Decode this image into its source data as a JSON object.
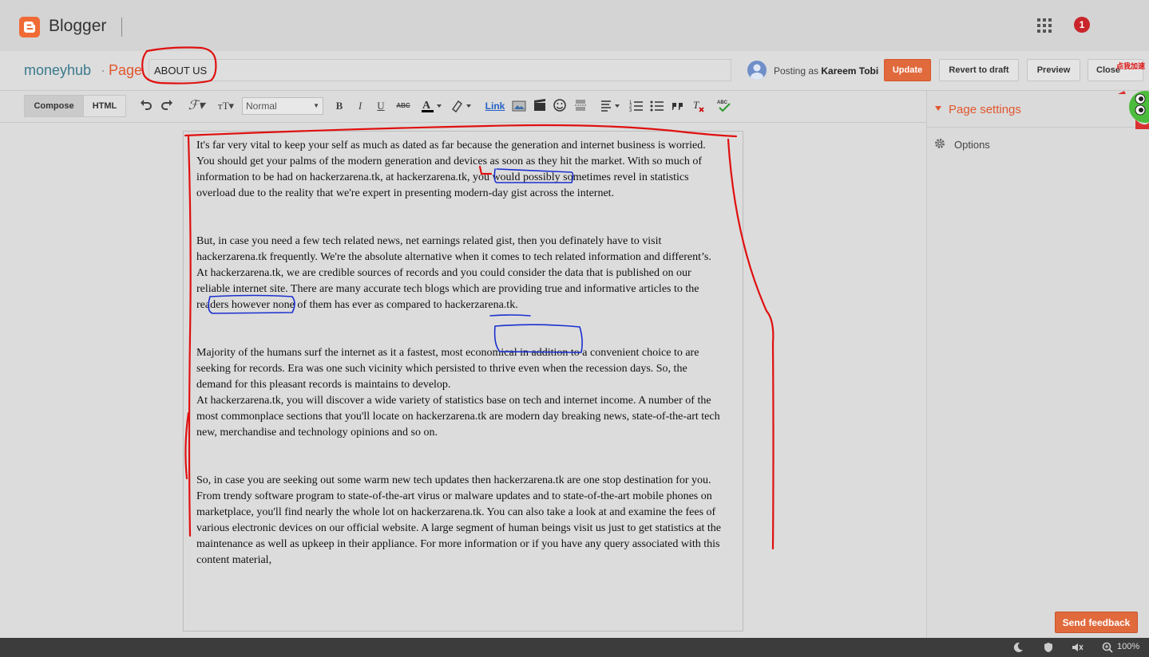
{
  "topbar": {
    "brand": "Blogger",
    "notification_count": "1"
  },
  "titlerow": {
    "blog_name": "moneyhub",
    "separator": "·",
    "page_label": "Page",
    "title_value": "ABOUT US",
    "posting_prefix": "Posting as",
    "user_name": "Kareem Tobi",
    "update": "Update",
    "revert": "Revert to draft",
    "preview": "Preview",
    "close": "Close"
  },
  "toolbar": {
    "compose": "Compose",
    "html": "HTML",
    "format": "Normal",
    "link": "Link",
    "bold": "B",
    "italic": "I",
    "underline": "U",
    "strike": "ABC"
  },
  "content": {
    "paragraphs": [
      "It's far very vital to keep your self as much as dated as far because the generation and internet business is worried. You should get your palms of the modern generation and devices as soon as they hit the market. With so much of information to be had on hackerzarena.tk, at hackerzarena.tk, you would possibly sometimes revel in statistics overload due to the reality that we're expert in presenting modern-day gist across the internet.",
      "But, in case you need a few tech related news, net earnings related gist, then you definately have to visit hackerzarena.tk frequently. We're the absolute alternative when it comes to tech related information and different’s.",
      "At hackerzarena.tk, we are credible sources of records and you could consider the data that is published on our reliable internet site. There are many accurate tech blogs which are providing true and informative articles to the readers however none of them has ever as compared to hackerzarena.tk.",
      "Majority of the humans surf the internet as it a fastest, most economical in addition to a convenient choice to are seeking for records.  Era was one such vicinity which persisted to thrive even when the recession days. So, the demand for this pleasant records is maintains to develop.",
      "At hackerzarena.tk, you will discover a wide variety of statistics base on tech and internet income. A number of the most commonplace sections that you'll locate on hackerzarena.tk are modern day breaking news, state-of-the-art tech new, merchandise and technology opinions and so on.",
      "So, in case you are seeking out some warm new tech updates then hackerzarena.tk are one stop destination for you. From trendy software program to state-of-the-art virus or malware updates and to state-of-the-art mobile phones on marketplace, you'll find nearly the whole lot on hackerzarena.tk. You can also take a look at and examine the fees of various electronic devices on our official website. A large segment of human beings visit us just to get statistics at the maintenance as well as upkeep in their appliance. For more information or if you have any query associated with this content material,"
    ]
  },
  "sidepanel": {
    "page_settings": "Page settings",
    "options": "Options",
    "feedback": "Send feedback"
  },
  "statusbar": {
    "zoom": "100%"
  },
  "mascot_badge": "点我加速",
  "colors": {
    "accent": "#e16a3d",
    "annotation_red": "#e01010",
    "annotation_blue": "#1a2fd0"
  }
}
